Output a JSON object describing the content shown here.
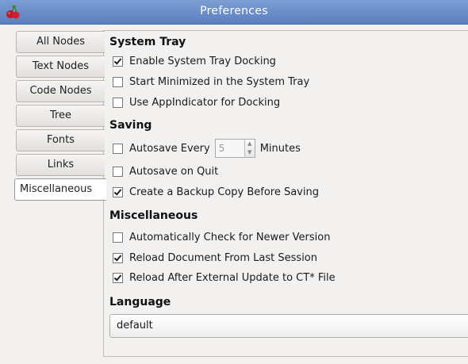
{
  "window": {
    "title": "Preferences",
    "icon": "cherry-icon"
  },
  "tabs": [
    {
      "label": "All Nodes",
      "active": false
    },
    {
      "label": "Text Nodes",
      "active": false
    },
    {
      "label": "Code Nodes",
      "active": false
    },
    {
      "label": "Tree",
      "active": false
    },
    {
      "label": "Fonts",
      "active": false
    },
    {
      "label": "Links",
      "active": false
    },
    {
      "label": "Miscellaneous",
      "active": true
    }
  ],
  "system_tray": {
    "title": "System Tray",
    "options": [
      {
        "label": "Enable System Tray Docking",
        "checked": true
      },
      {
        "label": "Start Minimized in the System Tray",
        "checked": false
      },
      {
        "label": "Use AppIndicator for Docking",
        "checked": false
      }
    ]
  },
  "saving": {
    "title": "Saving",
    "autosave_every": {
      "label": "Autosave Every",
      "value": "5",
      "suffix": "Minutes",
      "checked": false
    },
    "autosave_on_quit": {
      "label": "Autosave on Quit",
      "checked": false
    },
    "backup_copy": {
      "label": "Create a Backup Copy Before Saving",
      "checked": true
    }
  },
  "miscellaneous": {
    "title": "Miscellaneous",
    "options": [
      {
        "label": "Automatically Check for Newer Version",
        "checked": false
      },
      {
        "label": "Reload Document From Last Session",
        "checked": true
      },
      {
        "label": "Reload After External Update to CT* File",
        "checked": true
      }
    ]
  },
  "language": {
    "title": "Language",
    "value": "default"
  }
}
